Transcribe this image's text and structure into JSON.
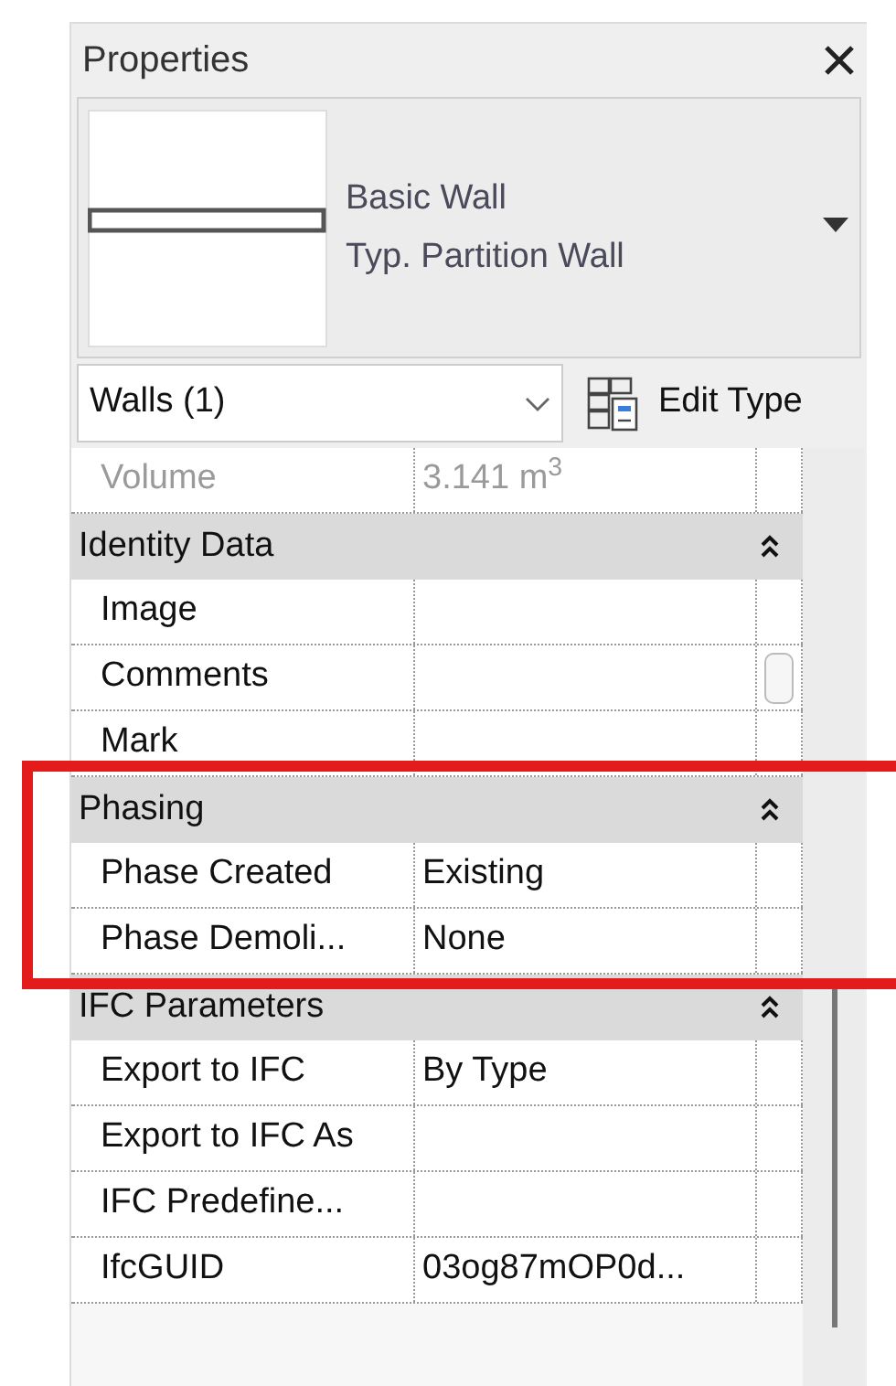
{
  "panel": {
    "title": "Properties"
  },
  "type_selector": {
    "family": "Basic Wall",
    "type": "Typ. Partition Wall"
  },
  "category_filter": {
    "value": "Walls (1)"
  },
  "edit_type_button": {
    "label": "Edit Type"
  },
  "top_rows": [
    {
      "label": "Volume",
      "value": "3.141 m$^{3}$",
      "disabled": true
    }
  ],
  "groups": [
    {
      "name": "Identity Data",
      "expanded": true,
      "rows": [
        {
          "label": "Image",
          "value": null,
          "disabled": false
        },
        {
          "label": "Comments",
          "value": null,
          "disabled": false,
          "kind": "handle"
        },
        {
          "label": "Mark",
          "value": null,
          "disabled": false
        }
      ]
    },
    {
      "name": "Phasing",
      "expanded": true,
      "rows": [
        {
          "label": "Phase Created",
          "value": "Existing",
          "disabled": false
        },
        {
          "label": "Phase Demoli...",
          "value": "None",
          "disabled": false
        }
      ]
    },
    {
      "name": "IFC Parameters",
      "expanded": true,
      "rows": [
        {
          "label": "Export to IFC",
          "value": "By Type",
          "disabled": false
        },
        {
          "label": "Export to IFC As",
          "value": null,
          "disabled": false
        },
        {
          "label": "IFC Predefine...",
          "value": null,
          "disabled": false
        },
        {
          "label": "IfcGUID",
          "value": "03og87mOP0d...",
          "disabled": false
        }
      ]
    }
  ],
  "highlight": {
    "color": "#e31b1b"
  }
}
